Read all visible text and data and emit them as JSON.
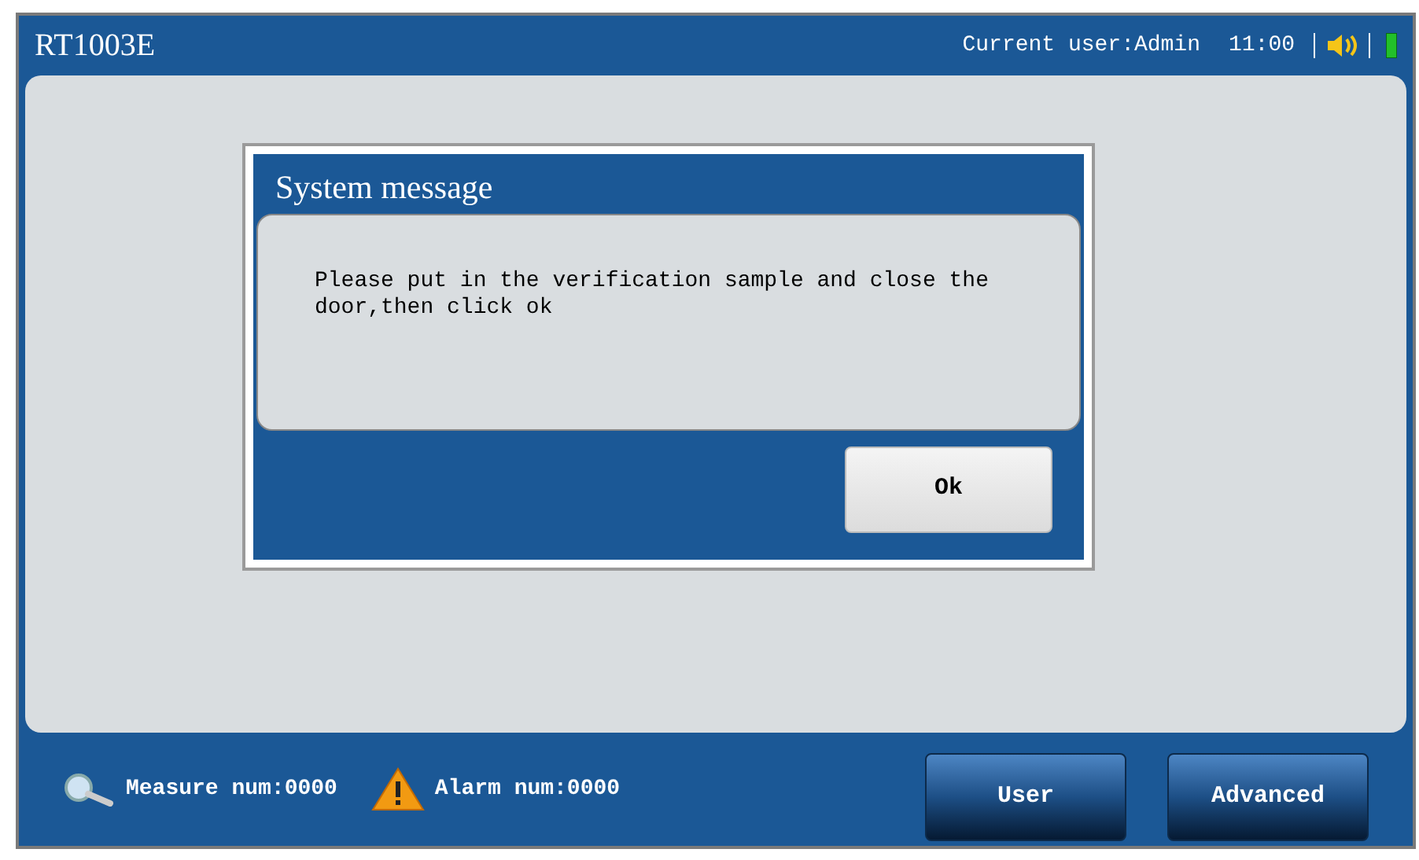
{
  "header": {
    "title": "RT1003E",
    "user": "Current user:Admin",
    "time": "11:00"
  },
  "dialog": {
    "title": "System message",
    "message": "Please put in the verification sample and close the door,then click ok",
    "button": "Ok"
  },
  "footer": {
    "measure": "Measure num:0000",
    "alarm": "Alarm num:0000",
    "buttons": [
      "User",
      "Advanced"
    ]
  }
}
